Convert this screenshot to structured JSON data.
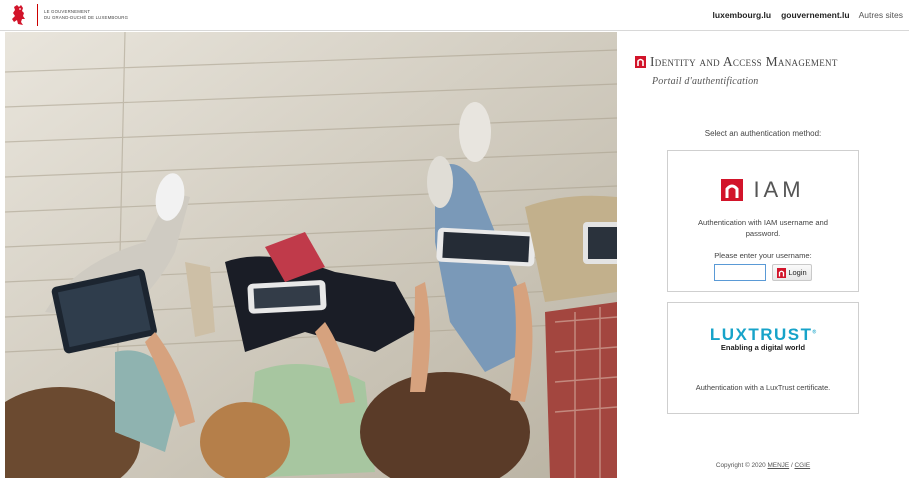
{
  "header": {
    "gov_line1": "Le Gouvernement",
    "gov_line2": "du Grand-Duché de Luxembourg",
    "links": [
      "luxembourg.lu",
      "gouvernement.lu"
    ],
    "other_sites": "Autres sites"
  },
  "photo": {
    "icon": "photo-people-with-tablets"
  },
  "panel": {
    "title": "Identity and Access Management",
    "subtitle": "Portail d'authentification",
    "select_label": "Select an authentication method:",
    "iam": {
      "logo_text": "IAM",
      "description": "Authentication with IAM username and password.",
      "prompt": "Please enter your username:",
      "username_value": "",
      "login_label": "Login"
    },
    "luxtrust": {
      "brand": "LUXTRUST",
      "trademark": "®",
      "tagline": "Enabling a digital world",
      "description": "Authentication with a LuxTrust certificate."
    },
    "copyright": {
      "prefix": "Copyright © 2020",
      "link1": "MENJE",
      "separator": "/",
      "link2": "CGIE"
    }
  },
  "colors": {
    "brand_red": "#d2142a",
    "luxtrust_blue": "#17a3c9",
    "input_border": "#5a9ad6"
  }
}
